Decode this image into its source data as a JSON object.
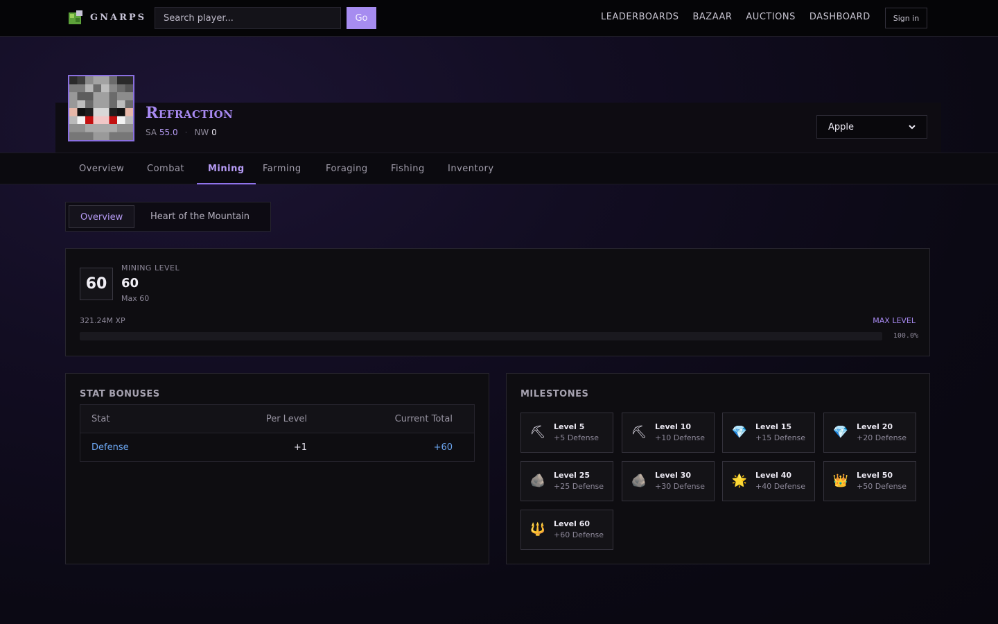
{
  "nav": {
    "logo_text": "GNARPS",
    "search_placeholder": "Search player...",
    "go_label": "Go",
    "links": [
      "LEADERBOARDS",
      "BAZAAR",
      "AUCTIONS",
      "DASHBOARD"
    ],
    "signin_label": "Sign in"
  },
  "player": {
    "name": "Refraction",
    "sa_label": "SA",
    "sa_value": "55.0",
    "nw_label": "NW",
    "nw_value": "0",
    "profile": "Apple"
  },
  "tabs": [
    "Overview",
    "Combat",
    "Mining",
    "Farming",
    "Foraging",
    "Fishing",
    "Inventory"
  ],
  "active_tab": "Mining",
  "subtabs": [
    "Overview",
    "Heart of the Mountain"
  ],
  "level": {
    "badge": "60",
    "caption": "MINING LEVEL",
    "value": "60",
    "max": "Max 60",
    "xp": "321.24M XP",
    "status": "MAX LEVEL",
    "percent_text": "100.0%",
    "progress": 1.0
  },
  "stat_bonuses": {
    "title": "STAT BONUSES",
    "headers": [
      "Stat",
      "Per Level",
      "Current Total"
    ],
    "rows": [
      {
        "stat": "Defense",
        "per_level": "+1",
        "total": "+60"
      }
    ]
  },
  "milestones": {
    "title": "MILESTONES",
    "items": [
      {
        "title": "Level 5",
        "sub": "+5 Defense",
        "icon": "pickaxe-icon",
        "glyph": "⛏"
      },
      {
        "title": "Level 10",
        "sub": "+10 Defense",
        "icon": "pickaxe-icon",
        "glyph": "⛏"
      },
      {
        "title": "Level 15",
        "sub": "+15 Defense",
        "icon": "diamond-icon",
        "glyph": "💎"
      },
      {
        "title": "Level 20",
        "sub": "+20 Defense",
        "icon": "diamond-icon",
        "glyph": "💎"
      },
      {
        "title": "Level 25",
        "sub": "+25 Defense",
        "icon": "rock-icon",
        "glyph": "🪨"
      },
      {
        "title": "Level 30",
        "sub": "+30 Defense",
        "icon": "rock-icon",
        "glyph": "🪨"
      },
      {
        "title": "Level 40",
        "sub": "+40 Defense",
        "icon": "star-icon",
        "glyph": "🌟"
      },
      {
        "title": "Level 50",
        "sub": "+50 Defense",
        "icon": "crown-icon",
        "glyph": "👑"
      },
      {
        "title": "Level 60",
        "sub": "+60 Defense",
        "icon": "trident-icon",
        "glyph": "🔱"
      }
    ]
  },
  "colors": {
    "accent": "#a88af2",
    "stat_blue": "#6ba5f0"
  }
}
